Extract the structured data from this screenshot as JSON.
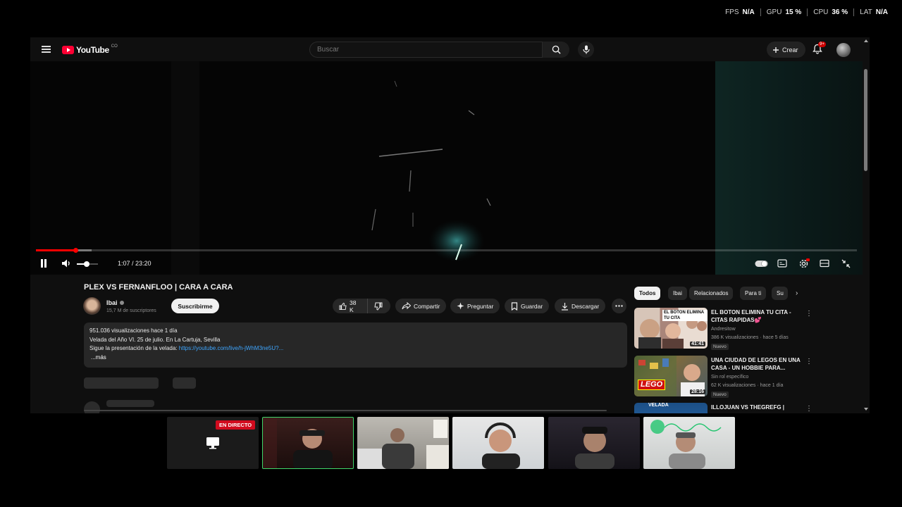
{
  "perf": {
    "fps_label": "FPS",
    "fps_value": "N/A",
    "gpu_label": "GPU",
    "gpu_value": "15 %",
    "cpu_label": "CPU",
    "cpu_value": "36 %",
    "lat_label": "LAT",
    "lat_value": "N/A"
  },
  "header": {
    "logo_text": "YouTube",
    "logo_country": "CO",
    "search_placeholder": "Buscar",
    "create_label": "Crear",
    "notifications_badge": "9+"
  },
  "player": {
    "time": "1:07 / 23:20",
    "progress_fraction": 0.0479,
    "buffered_fraction": 0.068,
    "volume_fraction": 0.45
  },
  "video": {
    "title": "PLEX VS FERNANFLOO | CARA A CARA",
    "channel_name": "Ibai",
    "subscribers": "15,7 M de suscriptores",
    "subscribe_label": "Suscribirme",
    "likes": "38 K",
    "share_label": "Compartir",
    "ask_label": "Preguntar",
    "save_label": "Guardar",
    "download_label": "Descargar"
  },
  "description": {
    "line1": "951.036 visualizaciones  hace 1 día",
    "line2": "Velada del Año VI. 25 de julio. En La Cartuja, Sevilla",
    "line3_text": "Sigue la presentación de la velada: ",
    "line3_link": "https://youtube.com/live/h-jWhM3ne5U?...",
    "more": "...más"
  },
  "sidebar": {
    "chips": [
      "Todos",
      "Ibai",
      "Relacionados",
      "Para ti",
      "Su"
    ],
    "recommendations": [
      {
        "title": "EL BOTON ELIMINA TU CITA - CITAS RAPIDAS💕",
        "channel": "Andresitow",
        "meta": "386 K visualizaciones · hace 5 días",
        "badge": "Nuevo",
        "duration": "41:41",
        "thumb_text": "EL BOTON ELIMINA TU CITA"
      },
      {
        "title": "UNA CIUDAD DE LEGOS EN UNA CASA - UN HOBBIE PARA...",
        "channel": "Sin rol específico",
        "meta": "62 K visualizaciones · hace 1 día",
        "badge": "Nuevo",
        "duration": "28:16",
        "thumb_text": "LEGO"
      },
      {
        "title": "ILLOJUAN VS THEGREFG |",
        "thumb_text": "VELADA"
      }
    ]
  },
  "stream": {
    "live_label": "EN DIRECTO"
  }
}
